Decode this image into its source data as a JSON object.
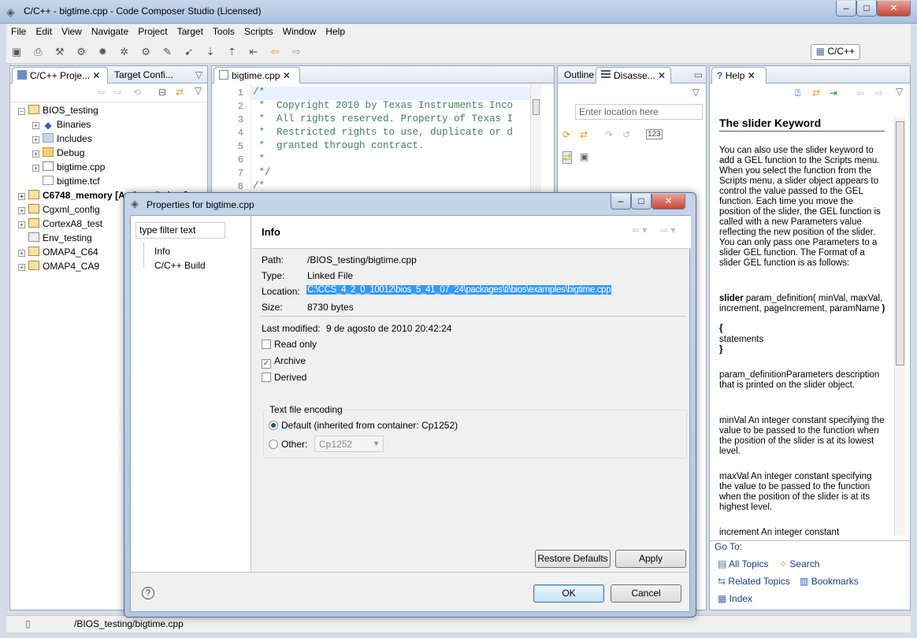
{
  "window": {
    "title": "C/C++ - bigtime.cpp - Code Composer Studio (Licensed)",
    "minimize": "–",
    "maximize": "□",
    "close": "✕"
  },
  "menubar": [
    "File",
    "Edit",
    "View",
    "Navigate",
    "Project",
    "Target",
    "Tools",
    "Scripts",
    "Window",
    "Help"
  ],
  "perspective": {
    "label": "C/C++"
  },
  "left_pane": {
    "tabs": [
      "C/C++ Proje...",
      "Target Confi..."
    ],
    "tree": [
      {
        "label": "BIOS_testing",
        "level": 0,
        "expanded": true
      },
      {
        "label": "Binaries",
        "level": 1
      },
      {
        "label": "Includes",
        "level": 1
      },
      {
        "label": "Debug",
        "level": 1
      },
      {
        "label": "bigtime.cpp",
        "level": 1
      },
      {
        "label": "bigtime.tcf",
        "level": 1
      },
      {
        "label": "C6748_memory",
        "level": 0,
        "bold": true,
        "suffix": "[Active - Debug]"
      },
      {
        "label": "Cgxml_config",
        "level": 0
      },
      {
        "label": "CortexA8_test",
        "level": 0
      },
      {
        "label": "Env_testing",
        "level": 0
      },
      {
        "label": "OMAP4_C64",
        "level": 0
      },
      {
        "label": "OMAP4_CA9",
        "level": 0
      }
    ]
  },
  "editor": {
    "tab": "bigtime.cpp",
    "lines": [
      {
        "n": "1",
        "text": "/*"
      },
      {
        "n": "2",
        "text": " *  Copyright 2010 by Texas Instruments Inco"
      },
      {
        "n": "3",
        "text": " *  All rights reserved. Property of Texas I"
      },
      {
        "n": "4",
        "text": " *  Restricted rights to use, duplicate or d"
      },
      {
        "n": "5",
        "text": " *  granted through contract."
      },
      {
        "n": "6",
        "text": " *"
      },
      {
        "n": "7",
        "text": " */"
      },
      {
        "n": "8",
        "text": "/*"
      }
    ]
  },
  "outline_pane": {
    "tabs": [
      "Outline",
      "Disasse..."
    ],
    "location_placeholder": "Enter location here"
  },
  "help_pane": {
    "tab": "Help",
    "heading": "The slider Keyword",
    "para1": "You can also use the slider keyword to add a GEL function to the Scripts menu. When you select the function from the Scripts menu, a slider object appears to control the value passed to the GEL function. Each time you move the position of the slider, the GEL function is called with a new Parameters value reflecting the new position of the slider. You can only pass one Parameters to a slider GEL function. The Format of a slider GEL function is as follows:",
    "code_kw": "slider",
    "code_rest": " param_definition( minVal, maxVal, increment, pageIncrement, paramName ",
    "code_close": ")",
    "brace_open": "{",
    "statements": "statements",
    "brace_close": "}",
    "para2": "param_definitionParameters description that is printed on the slider object.",
    "para3": "minVal An integer constant specifying the value to be passed to the function when the position of the slider is at its lowest level.",
    "para4": "maxVal An integer constant specifying the value to be passed to the function when the position of the slider is at its highest level.",
    "para5": "increment An integer constant",
    "goto_label": "Go To:",
    "links": [
      "All Topics",
      "Search",
      "Related Topics",
      "Bookmarks",
      "Index"
    ]
  },
  "dialog": {
    "title": "Properties for bigtime.cpp",
    "filter_placeholder": "type filter text",
    "nav": [
      "Info",
      "C/C++ Build"
    ],
    "section_title": "Info",
    "path_label": "Path:",
    "path_value": "/BIOS_testing/bigtime.cpp",
    "type_label": "Type:",
    "type_value": "Linked File",
    "location_label": "Location:",
    "location_value": "C:\\CCS_4_2_0_10012\\bios_5_41_07_24\\packages\\ti\\bios\\examples\\bigtime.cpp",
    "size_label": "Size:",
    "size_value": "8730  bytes",
    "modified_label": "Last modified:",
    "modified_value": "9 de agosto de 2010 20:42:24",
    "read_only": "Read only",
    "archive": "Archive",
    "derived": "Derived",
    "encoding_group": "Text file encoding",
    "default_option": "Default (inherited from container: Cp1252)",
    "other_option": "Other:",
    "other_value": "Cp1252",
    "restore_defaults": "Restore Defaults",
    "apply": "Apply",
    "ok": "OK",
    "cancel": "Cancel",
    "help_glyph": "?"
  },
  "statusbar": {
    "text": "/BIOS_testing/bigtime.cpp"
  }
}
